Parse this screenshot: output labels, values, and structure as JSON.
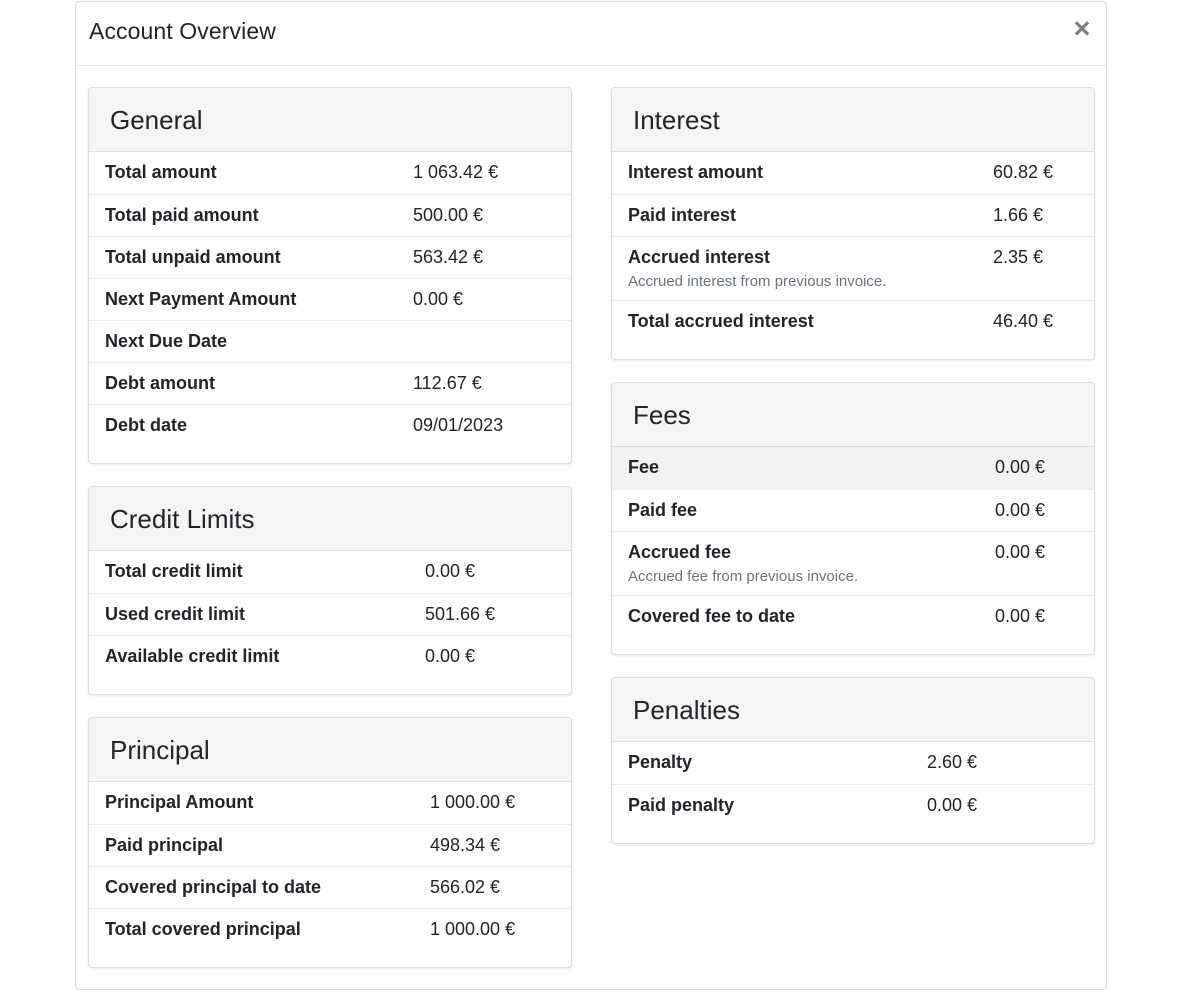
{
  "modal": {
    "title": "Account Overview",
    "close_label": "×"
  },
  "general": {
    "title": "General",
    "rows": [
      {
        "label": "Total amount",
        "value": "1 063.42 €"
      },
      {
        "label": "Total paid amount",
        "value": "500.00 €"
      },
      {
        "label": "Total unpaid amount",
        "value": "563.42 €"
      },
      {
        "label": "Next Payment Amount",
        "value": "0.00 €"
      },
      {
        "label": "Next Due Date",
        "value": ""
      },
      {
        "label": "Debt amount",
        "value": "112.67 €"
      },
      {
        "label": "Debt date",
        "value": "09/01/2023"
      }
    ]
  },
  "credit": {
    "title": "Credit Limits",
    "rows": [
      {
        "label": "Total credit limit",
        "value": "0.00 €"
      },
      {
        "label": "Used credit limit",
        "value": "501.66 €"
      },
      {
        "label": "Available credit limit",
        "value": "0.00 €"
      }
    ]
  },
  "principal": {
    "title": "Principal",
    "rows": [
      {
        "label": "Principal Amount",
        "value": "1 000.00 €"
      },
      {
        "label": "Paid principal",
        "value": "498.34 €"
      },
      {
        "label": "Covered principal to date",
        "value": "566.02 €"
      },
      {
        "label": "Total covered principal",
        "value": "1 000.00 €"
      }
    ]
  },
  "interest": {
    "title": "Interest",
    "rows": [
      {
        "label": "Interest amount",
        "value": "60.82 €"
      },
      {
        "label": "Paid interest",
        "value": "1.66 €"
      },
      {
        "label": "Accrued interest",
        "value": "2.35 €",
        "description": "Accrued interest from previous invoice."
      },
      {
        "label": "Total accrued interest",
        "value": "46.40 €"
      }
    ]
  },
  "fees": {
    "title": "Fees",
    "rows": [
      {
        "label": "Fee",
        "value": "0.00 €"
      },
      {
        "label": "Paid fee",
        "value": "0.00 €"
      },
      {
        "label": "Accrued fee",
        "value": "0.00 €",
        "description": "Accrued fee from previous invoice."
      },
      {
        "label": "Covered fee to date",
        "value": "0.00 €"
      }
    ]
  },
  "penalties": {
    "title": "Penalties",
    "rows": [
      {
        "label": "Penalty",
        "value": "2.60 €"
      },
      {
        "label": "Paid penalty",
        "value": "0.00 €"
      }
    ]
  }
}
